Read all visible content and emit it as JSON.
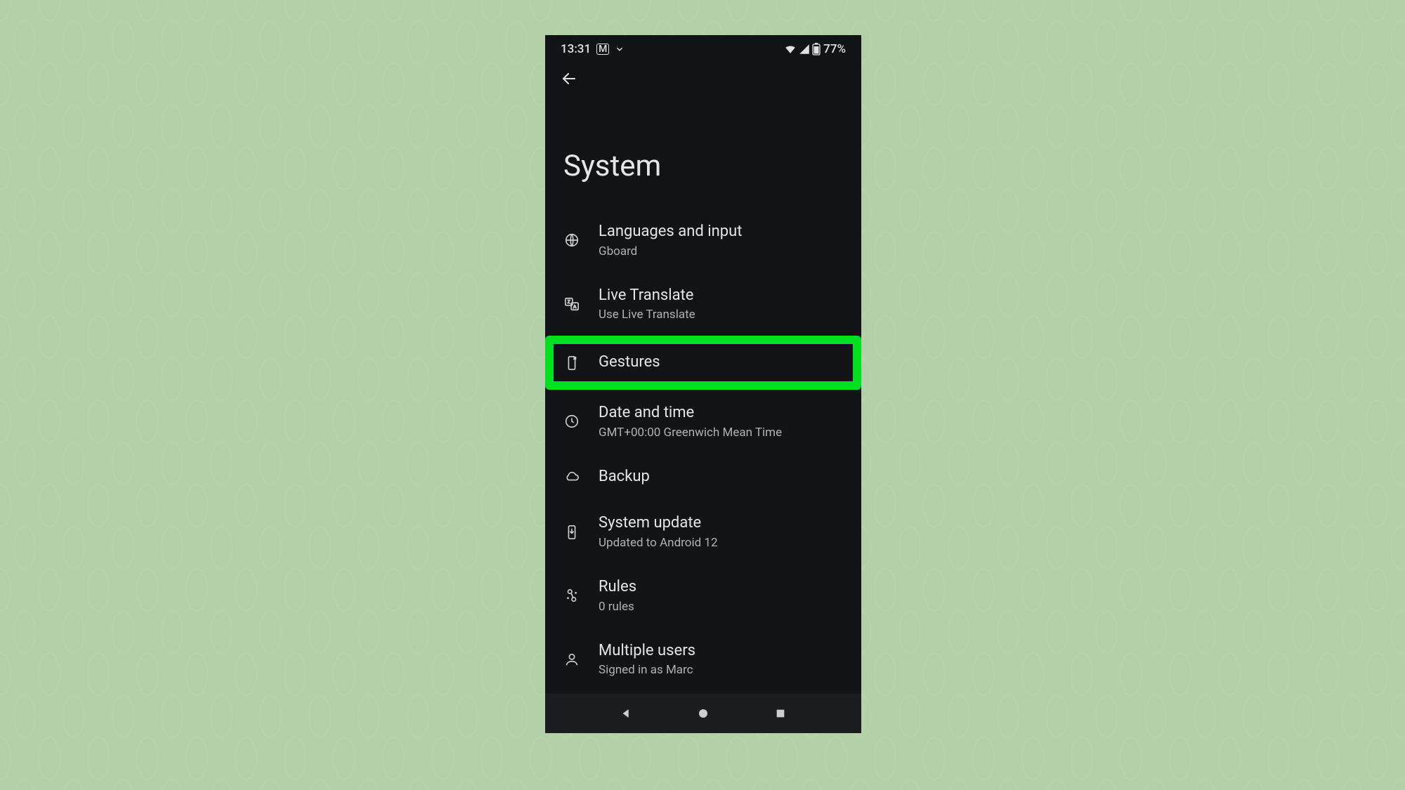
{
  "status": {
    "time": "13:31",
    "battery": "77%"
  },
  "page": {
    "title": "System"
  },
  "items": [
    {
      "title": "Languages and input",
      "sub": "Gboard"
    },
    {
      "title": "Live Translate",
      "sub": "Use Live Translate"
    },
    {
      "title": "Gestures",
      "sub": ""
    },
    {
      "title": "Date and time",
      "sub": "GMT+00:00 Greenwich Mean Time"
    },
    {
      "title": "Backup",
      "sub": ""
    },
    {
      "title": "System update",
      "sub": "Updated to Android 12"
    },
    {
      "title": "Rules",
      "sub": "0 rules"
    },
    {
      "title": "Multiple users",
      "sub": "Signed in as Marc"
    }
  ]
}
